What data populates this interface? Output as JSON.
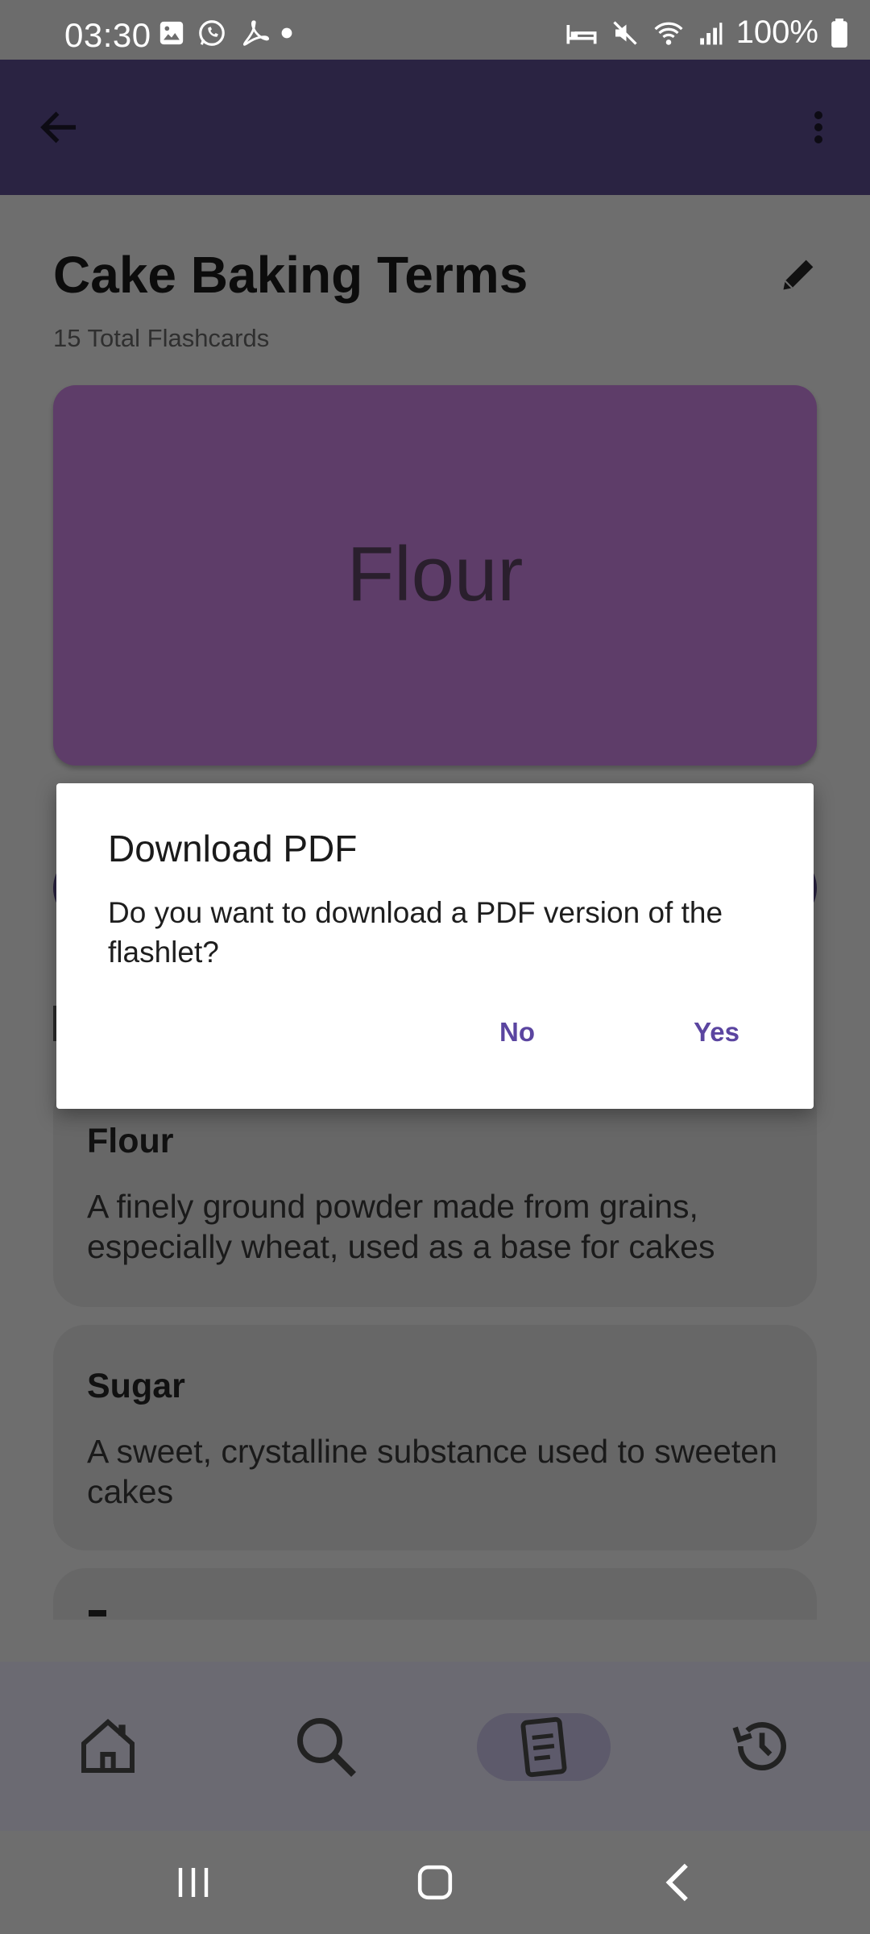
{
  "status_bar": {
    "time": "03:30",
    "battery": "100%",
    "left_icons": [
      "gallery-icon",
      "whatsapp-icon",
      "acrobat-icon",
      "dot-icon"
    ],
    "right_icons": [
      "alarm-bed-icon",
      "mute-icon",
      "wifi-icon",
      "signal-icon",
      "battery-icon"
    ]
  },
  "app_bar": {
    "back_icon": "arrow-left-icon",
    "menu_icon": "more-vert-icon"
  },
  "flashlet": {
    "title": "Cake Baking Terms",
    "count_text": "15 Total Flashcards",
    "preview_term": "Flour"
  },
  "terms": [
    {
      "term": "Flour",
      "definition": "A finely ground powder made from grains, especially wheat, used as a base for cakes"
    },
    {
      "term": "Sugar",
      "definition": "A sweet, crystalline substance used to sweeten cakes"
    }
  ],
  "dialog": {
    "title": "Download PDF",
    "message": "Do you want to download a PDF version of the flashlet?",
    "no_label": "No",
    "yes_label": "Yes"
  },
  "bottom_nav": {
    "items": [
      "home-icon",
      "search-icon",
      "flashcards-icon",
      "history-icon"
    ],
    "selected": "flashcards-icon"
  },
  "colors": {
    "app_bar": "#2a2342",
    "card": "#5e3d69",
    "accent": "#5b45a0"
  }
}
